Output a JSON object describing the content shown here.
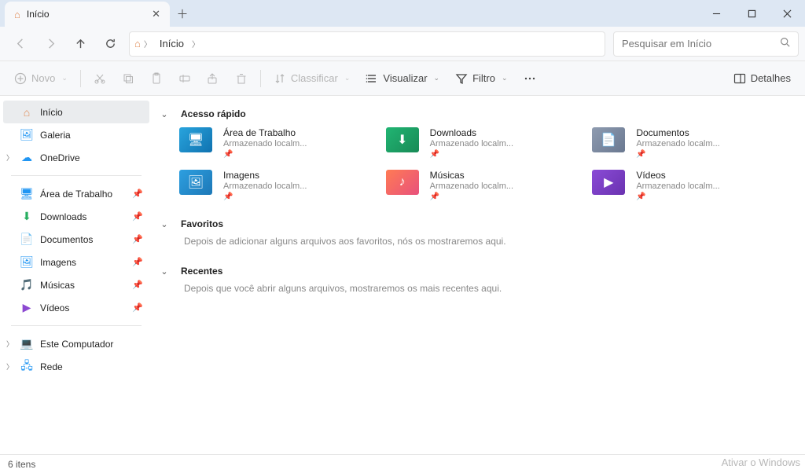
{
  "window": {
    "tab_title": "Início",
    "search_placeholder": "Pesquisar em Início",
    "breadcrumb": [
      "Início"
    ]
  },
  "commands": {
    "new": "Novo",
    "sort": "Classificar",
    "view": "Visualizar",
    "filter": "Filtro",
    "details": "Detalhes"
  },
  "sidebar": {
    "items": [
      {
        "icon": "home",
        "label": "Início",
        "active": true
      },
      {
        "icon": "gallery",
        "label": "Galeria"
      },
      {
        "icon": "onedrive",
        "label": "OneDrive",
        "expander": true
      }
    ],
    "pinned": [
      {
        "icon": "desktop",
        "label": "Área de Trabalho"
      },
      {
        "icon": "downloads",
        "label": "Downloads"
      },
      {
        "icon": "documents",
        "label": "Documentos"
      },
      {
        "icon": "pictures",
        "label": "Imagens"
      },
      {
        "icon": "music",
        "label": "Músicas"
      },
      {
        "icon": "videos",
        "label": "Vídeos"
      }
    ],
    "system": [
      {
        "icon": "thispc",
        "label": "Este Computador",
        "expander": true
      },
      {
        "icon": "network",
        "label": "Rede",
        "expander": true
      }
    ]
  },
  "sections": {
    "quick": {
      "title": "Acesso rápido",
      "stored_label": "Armazenado localm...",
      "tiles": [
        {
          "key": "desktop",
          "title": "Área de Trabalho"
        },
        {
          "key": "downloads",
          "title": "Downloads"
        },
        {
          "key": "documents",
          "title": "Documentos"
        },
        {
          "key": "pictures",
          "title": "Imagens"
        },
        {
          "key": "music",
          "title": "Músicas"
        },
        {
          "key": "videos",
          "title": "Vídeos"
        }
      ]
    },
    "favorites": {
      "title": "Favoritos",
      "empty": "Depois de adicionar alguns arquivos aos favoritos, nós os mostraremos aqui."
    },
    "recents": {
      "title": "Recentes",
      "empty": "Depois que você abrir alguns arquivos, mostraremos os mais recentes aqui."
    }
  },
  "status": {
    "text": "6 itens"
  },
  "watermark": "Ativar o Windows"
}
